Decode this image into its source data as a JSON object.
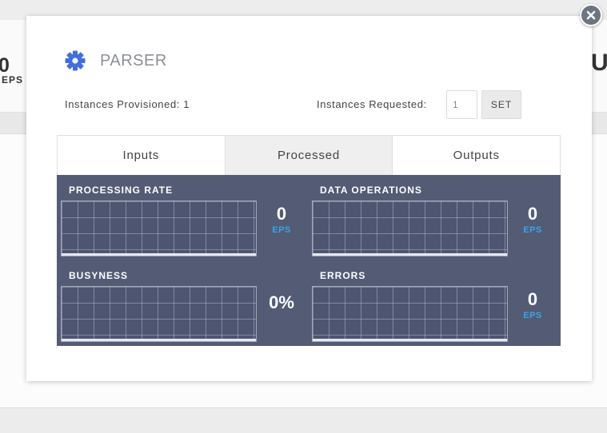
{
  "background": {
    "stat_value": "0",
    "stat_unit": "EPS",
    "right_fragment": "U"
  },
  "modal": {
    "title": "PARSER",
    "title_icon": "gear-icon",
    "close_icon": "close-icon",
    "instances_provisioned_label": "Instances Provisioned: 1",
    "instances_requested_label": "Instances Requested:",
    "instances_requested_value": "1",
    "set_label": "SET",
    "tabs": [
      {
        "label": "Inputs",
        "active": false
      },
      {
        "label": "Processed",
        "active": true
      },
      {
        "label": "Outputs",
        "active": false
      }
    ],
    "metrics": [
      {
        "label": "PROCESSING RATE",
        "value": "0",
        "unit": "EPS"
      },
      {
        "label": "DATA OPERATIONS",
        "value": "0",
        "unit": "EPS"
      },
      {
        "label": "BUSYNESS",
        "value": "0%",
        "unit": ""
      },
      {
        "label": "ERRORS",
        "value": "0",
        "unit": "EPS"
      }
    ]
  },
  "colors": {
    "panel": "#545b74",
    "accent_blue": "#3f6fe0",
    "unit_blue": "#35a7e8",
    "active_tab": "#efefef"
  }
}
